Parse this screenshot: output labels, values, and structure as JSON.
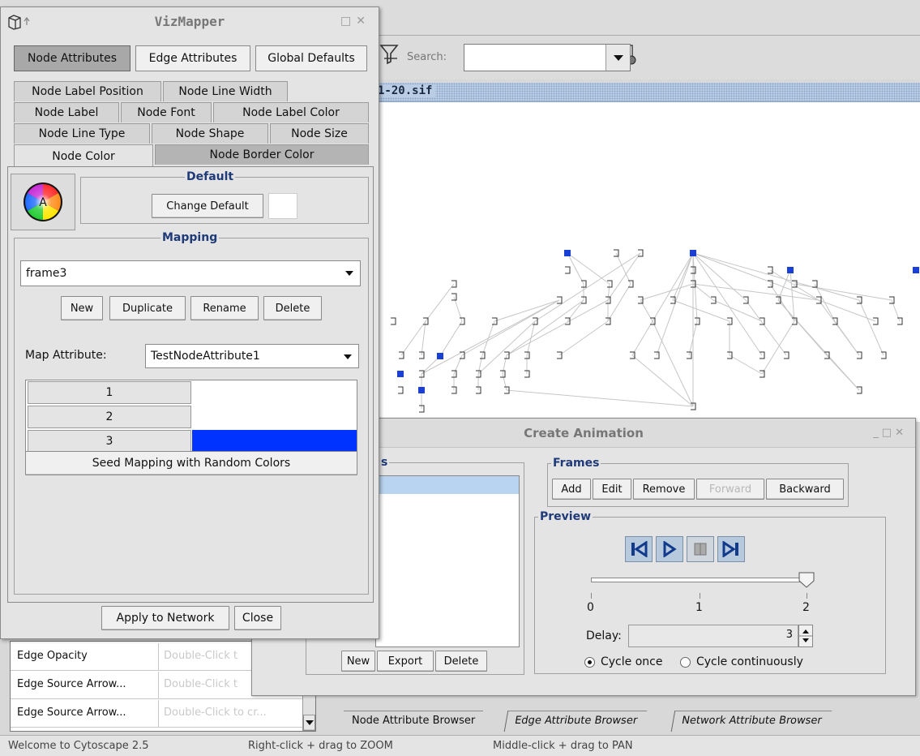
{
  "background_window": {
    "search_label": "Search:",
    "network_title": "1-20.sif",
    "browser_tabs": [
      "Node Attribute Browser",
      "Edge Attribute Browser",
      "Network Attribute Browser"
    ],
    "status": {
      "welcome": "Welcome to Cytoscape 2.5",
      "zoom_hint": "Right-click + drag to  ZOOM",
      "pan_hint": "Middle-click + drag to  PAN"
    },
    "visual_style_list": [
      {
        "property": "Edge Opacity",
        "value": "Double-Click t"
      },
      {
        "property": "Edge Source Arrow...",
        "value": "Double-Click t"
      },
      {
        "property": "Edge Source Arrow...",
        "value": "Double-Click to cr..."
      }
    ],
    "colors": {
      "node_selected": "#1a3fd4",
      "network_title_bg": "#b9cde4"
    }
  },
  "animation_dialog": {
    "title": "Create Animation",
    "frames_list_legend": "s",
    "frames_section": {
      "legend": "Frames",
      "buttons": [
        "Add",
        "Edit",
        "Remove",
        "Forward",
        "Backward"
      ],
      "disabled": [
        "Forward"
      ]
    },
    "preview": {
      "legend": "Preview",
      "controls": [
        "skip-to-start-icon",
        "play-icon",
        "pause-icon",
        "skip-to-end-icon"
      ],
      "slider_value": 2,
      "slider_min": 0,
      "slider_max": 2,
      "tick_labels": [
        "0",
        "1",
        "2"
      ],
      "delay_label": "Delay:",
      "delay_value": "3",
      "cycle_once": "Cycle once",
      "cycle_continuously": "Cycle continuously",
      "selected_cycle": "Cycle once"
    },
    "list_buttons": [
      "New",
      "Export",
      "Delete"
    ]
  },
  "vizmapper": {
    "title": "VizMapper",
    "toggles": [
      "Node Attributes",
      "Edge Attributes",
      "Global Defaults"
    ],
    "selected_toggle": "Node Attributes",
    "tabs": {
      "row1": [
        "Node Label Position",
        "Node Line Width"
      ],
      "row2": [
        "Node Label",
        "Node Font",
        "Node Label Color"
      ],
      "row3": [
        "Node Line Type",
        "Node Shape",
        "Node Size"
      ],
      "row4": [
        "Node Color",
        "Node Border Color"
      ]
    },
    "selected_tab": "Node Color",
    "default_legend": "Default",
    "change_default": "Change Default",
    "default_swatch_color": "#ffffff",
    "mapping_legend": "Mapping",
    "mapping_selected": "frame3",
    "mapping_buttons": [
      "New",
      "Duplicate",
      "Rename",
      "Delete"
    ],
    "map_attribute_label": "Map Attribute:",
    "map_attribute_value": "TestNodeAttribute1",
    "mapping_rows": [
      {
        "key": "1",
        "color": ""
      },
      {
        "key": "2",
        "color": ""
      },
      {
        "key": "3",
        "color": "#0033ff"
      }
    ],
    "seed_button": "Seed Mapping with Random Colors",
    "apply_button": "Apply to Network",
    "close_button": "Close",
    "icon_letter": "A"
  }
}
